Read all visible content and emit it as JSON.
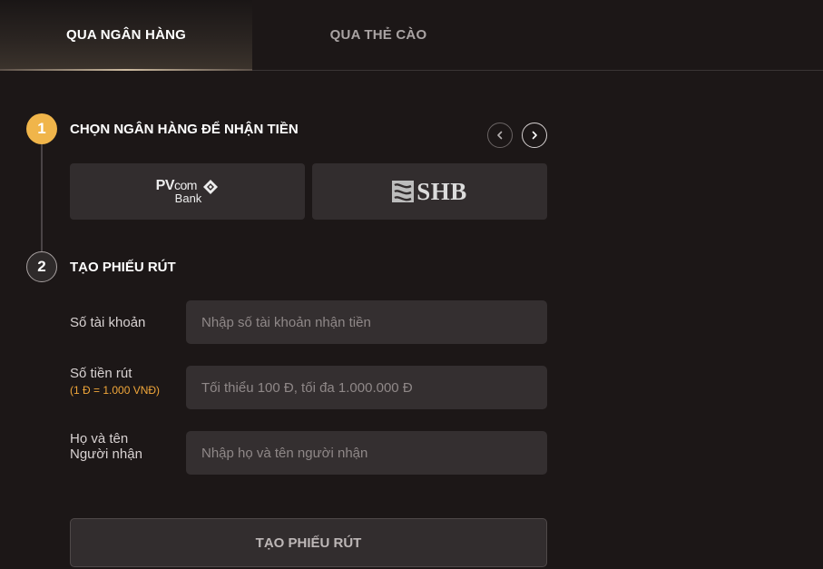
{
  "tabs": [
    {
      "label": "QUA NGÂN HÀNG",
      "active": true
    },
    {
      "label": "QUA THẺ CÀO",
      "active": false
    }
  ],
  "step1": {
    "number": "1",
    "title": "CHỌN NGÂN HÀNG ĐỂ NHẬN TIỀN"
  },
  "banks": [
    {
      "name": "PVcomBank",
      "logo_text_main": "PV",
      "logo_text_com": "com",
      "logo_text_sub": "Bank",
      "icon": "pvcombank-logo"
    },
    {
      "name": "SHB",
      "logo_text": "SHB",
      "icon": "shb-logo"
    }
  ],
  "step2": {
    "number": "2",
    "title": "TẠO PHIẾU RÚT"
  },
  "form": {
    "account": {
      "label": "Số tài khoản",
      "placeholder": "Nhập số tài khoản nhận tiền",
      "value": ""
    },
    "amount": {
      "label": "Số tiền rút",
      "note": "(1 Đ = 1.000 VNĐ)",
      "placeholder": "Tối thiểu 100 Đ, tối đa 1.000.000 Đ",
      "value": ""
    },
    "name": {
      "label_line1": "Họ và tên",
      "label_line2": "Người nhận",
      "placeholder": "Nhập họ và tên người nhận",
      "value": ""
    },
    "submit_label": "TẠO PHIẾU RÚT"
  },
  "colors": {
    "background": "#1c1717",
    "step_active": "#f0b54a",
    "note_accent": "#f0a63a",
    "card_bg": "#322d2e",
    "input_bg": "#342f30"
  }
}
